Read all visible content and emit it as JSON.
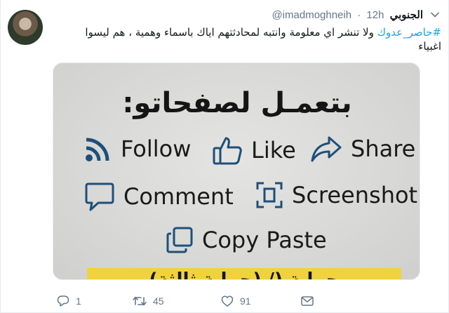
{
  "tweet": {
    "display_name": "الجنوبي",
    "handle": "@imadmoghneih",
    "dot": "·",
    "time": "12h",
    "hashtag": "#حاصر_عدوك",
    "text_line1": "ولا تنشر اي معلومة وانتبه لمحادثتهم اياك باسماء وهمية ، هم ليسوا",
    "text_line2": "اغبياء"
  },
  "media": {
    "headline": "بتعمـل لصفحاتو:",
    "items": {
      "follow": "Follow",
      "like": "Like",
      "share": "Share",
      "comment": "Comment",
      "screenshot": "Screenshot",
      "copy_paste": "Copy Paste"
    },
    "banner_text": "حماية (/ (حماية ثالثة)",
    "colors": {
      "icon_blue": "#1e4f7a",
      "banner_yellow": "#f2d23a",
      "background": "#d9d9d7"
    }
  },
  "actions": {
    "reply_count": "1",
    "retweet_count": "45",
    "like_count": "91"
  },
  "icons": [
    "avatar",
    "caret-down-icon",
    "rss-icon",
    "thumbs-up-icon",
    "share-arrow-icon",
    "comment-icon",
    "screenshot-icon",
    "copy-icon",
    "reply-icon",
    "retweet-icon",
    "heart-icon",
    "dm-icon"
  ]
}
